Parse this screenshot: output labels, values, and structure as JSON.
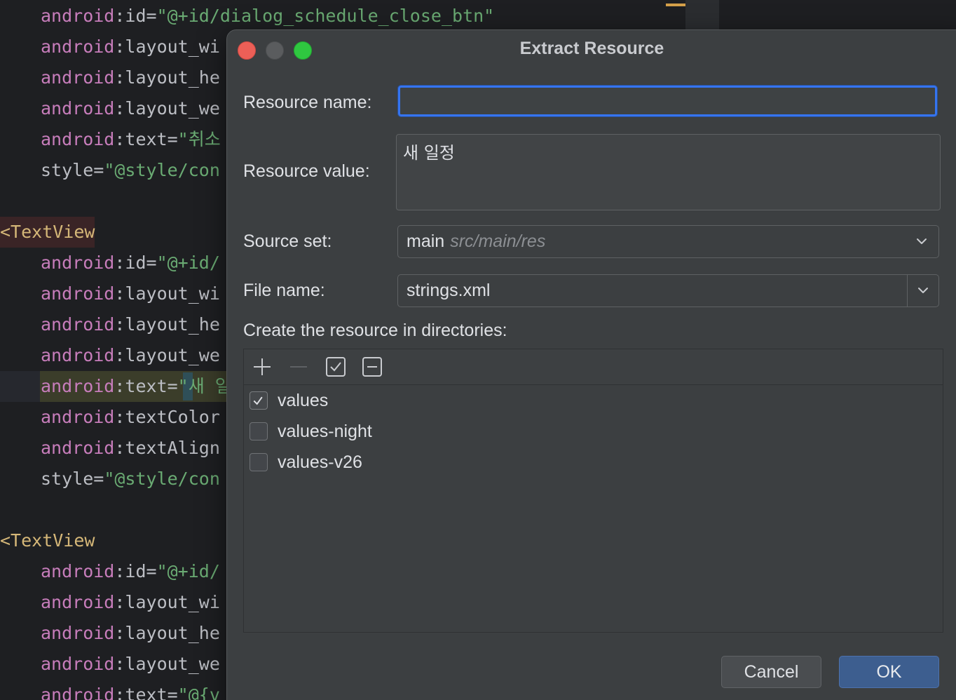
{
  "editor": {
    "lines": [
      {
        "indent": true,
        "parts": [
          [
            "attr",
            "android"
          ],
          [
            "plain",
            ":id="
          ],
          [
            "str",
            "\"@+id/dialog_schedule_close_btn\""
          ]
        ]
      },
      {
        "indent": true,
        "parts": [
          [
            "attr",
            "android"
          ],
          [
            "plain",
            ":layout_wi"
          ]
        ]
      },
      {
        "indent": true,
        "parts": [
          [
            "attr",
            "android"
          ],
          [
            "plain",
            ":layout_he"
          ]
        ]
      },
      {
        "indent": true,
        "parts": [
          [
            "attr",
            "android"
          ],
          [
            "plain",
            ":layout_we"
          ]
        ]
      },
      {
        "indent": true,
        "parts": [
          [
            "attr",
            "android"
          ],
          [
            "plain",
            ":text="
          ],
          [
            "str",
            "\"취소"
          ]
        ]
      },
      {
        "indent": true,
        "parts": [
          [
            "plain",
            "style="
          ],
          [
            "str",
            "\"@style/con"
          ]
        ]
      },
      {
        "indent": false,
        "parts": []
      },
      {
        "indent": false,
        "tag": true,
        "parts": [
          [
            "tag",
            "<TextView"
          ]
        ]
      },
      {
        "indent": true,
        "parts": [
          [
            "attr",
            "android"
          ],
          [
            "plain",
            ":id="
          ],
          [
            "str",
            "\"@+id/"
          ]
        ]
      },
      {
        "indent": true,
        "parts": [
          [
            "attr",
            "android"
          ],
          [
            "plain",
            ":layout_wi"
          ]
        ]
      },
      {
        "indent": true,
        "parts": [
          [
            "attr",
            "android"
          ],
          [
            "plain",
            ":layout_he"
          ]
        ]
      },
      {
        "indent": true,
        "parts": [
          [
            "attr",
            "android"
          ],
          [
            "plain",
            ":layout_we"
          ]
        ]
      },
      {
        "indent": true,
        "parts": [
          [
            "attr",
            "android"
          ],
          [
            "plain",
            ":text="
          ],
          [
            "str",
            "\"새 일"
          ]
        ]
      },
      {
        "indent": true,
        "parts": [
          [
            "attr",
            "android"
          ],
          [
            "plain",
            ":textColor"
          ]
        ]
      },
      {
        "indent": true,
        "parts": [
          [
            "attr",
            "android"
          ],
          [
            "plain",
            ":textAlign"
          ]
        ]
      },
      {
        "indent": true,
        "parts": [
          [
            "plain",
            "style="
          ],
          [
            "str",
            "\"@style/con"
          ]
        ]
      },
      {
        "indent": false,
        "parts": []
      },
      {
        "indent": false,
        "parts": [
          [
            "tag",
            "<TextView"
          ]
        ]
      },
      {
        "indent": true,
        "parts": [
          [
            "attr",
            "android"
          ],
          [
            "plain",
            ":id="
          ],
          [
            "str",
            "\"@+id/"
          ]
        ]
      },
      {
        "indent": true,
        "parts": [
          [
            "attr",
            "android"
          ],
          [
            "plain",
            ":layout_wi"
          ]
        ]
      },
      {
        "indent": true,
        "parts": [
          [
            "attr",
            "android"
          ],
          [
            "plain",
            ":layout_he"
          ]
        ]
      },
      {
        "indent": true,
        "parts": [
          [
            "attr",
            "android"
          ],
          [
            "plain",
            ":layout_we"
          ]
        ]
      },
      {
        "indent": true,
        "parts": [
          [
            "attr",
            "android"
          ],
          [
            "plain",
            ":text="
          ],
          [
            "str",
            "\"@{v"
          ]
        ]
      }
    ]
  },
  "dialog": {
    "title": "Extract Resource",
    "resource_name": {
      "label": "Resource name:",
      "value": ""
    },
    "resource_value": {
      "label": "Resource value:",
      "value": "새 일정"
    },
    "source_set": {
      "label": "Source set:",
      "value": "main",
      "hint": "src/main/res"
    },
    "file_name": {
      "label": "File name:",
      "value": "strings.xml"
    },
    "directories": {
      "label": "Create the resource in directories:",
      "items": [
        {
          "name": "values",
          "checked": true
        },
        {
          "name": "values-night",
          "checked": false
        },
        {
          "name": "values-v26",
          "checked": false
        }
      ]
    },
    "buttons": {
      "cancel": "Cancel",
      "ok": "OK"
    }
  },
  "colors": {
    "accent": "#3574f0",
    "ok_button": "#3d5e8f",
    "dialog_bg": "#3c3f41",
    "editor_bg": "#1e1f22",
    "close_light": "#ec5f57",
    "zoom_light": "#2fc740"
  },
  "icons": {
    "toolbar": [
      "plus-icon",
      "minus-icon",
      "check-all-icon",
      "uncheck-all-icon"
    ],
    "combo": "chevron-down-icon"
  }
}
